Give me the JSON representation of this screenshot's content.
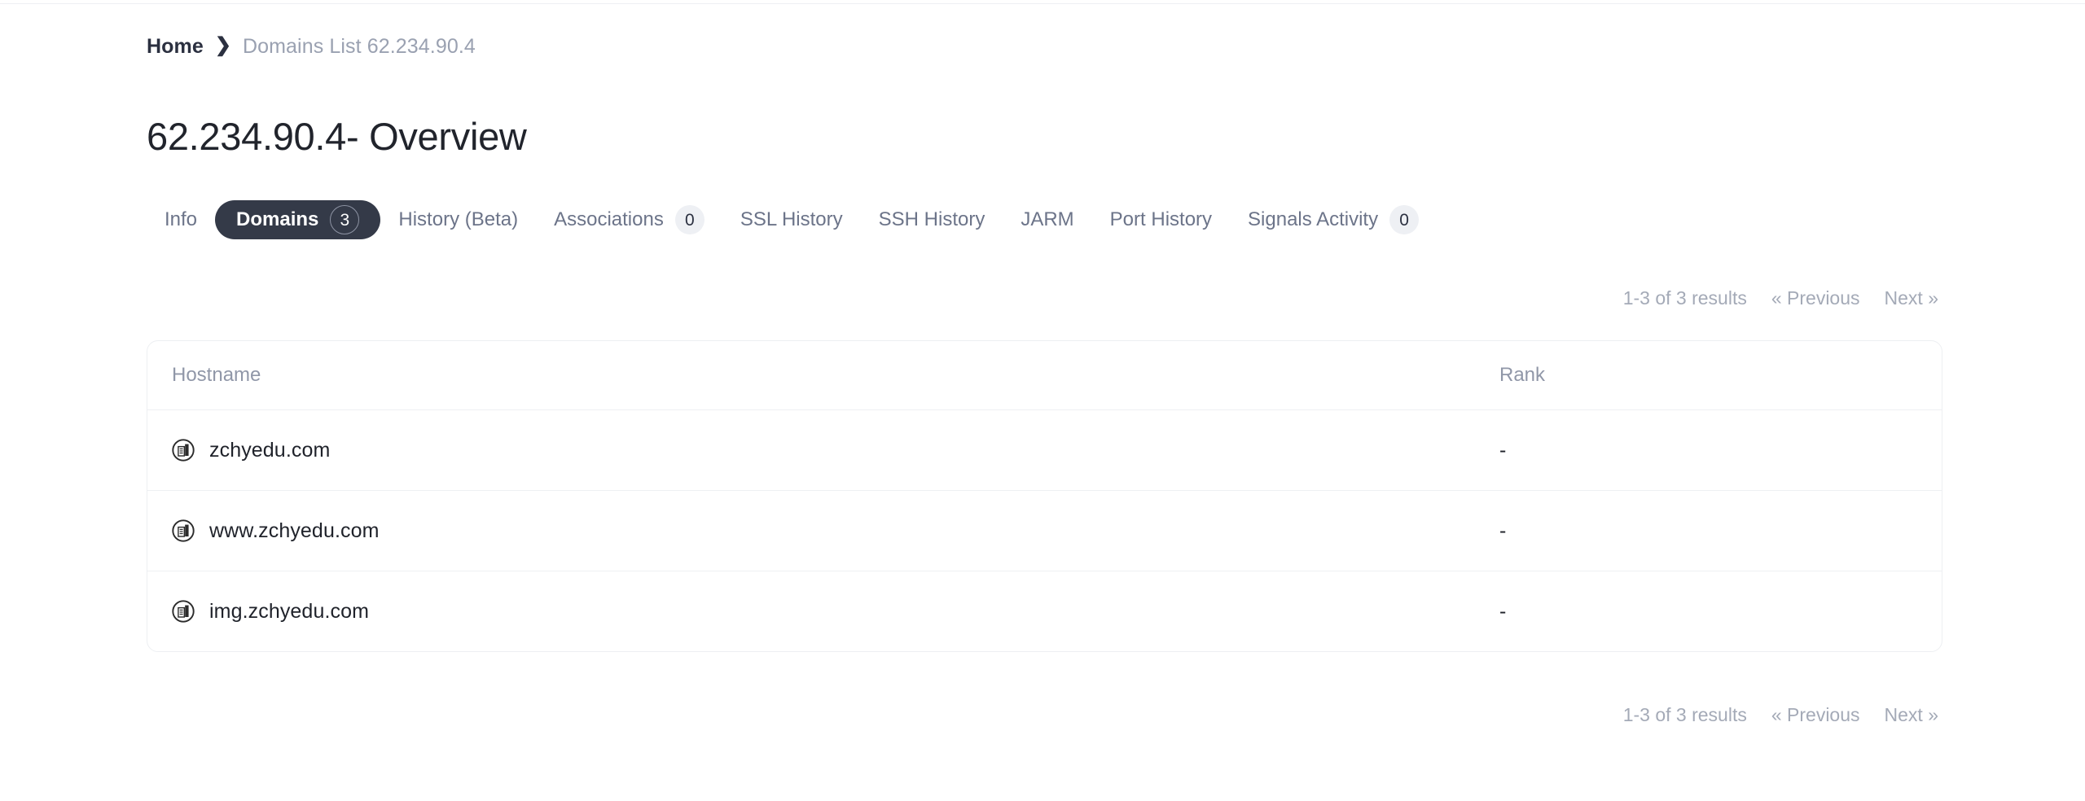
{
  "breadcrumb": {
    "home_label": "Home",
    "separator": "❯",
    "current_label": "Domains List 62.234.90.4"
  },
  "page_title": "62.234.90.4- Overview",
  "tabs": [
    {
      "label": "Info",
      "badge": null,
      "active": false
    },
    {
      "label": "Domains",
      "badge": "3",
      "active": true
    },
    {
      "label": "History (Beta)",
      "badge": null,
      "active": false
    },
    {
      "label": "Associations",
      "badge": "0",
      "active": false
    },
    {
      "label": "SSL History",
      "badge": null,
      "active": false
    },
    {
      "label": "SSH History",
      "badge": null,
      "active": false
    },
    {
      "label": "JARM",
      "badge": null,
      "active": false
    },
    {
      "label": "Port History",
      "badge": null,
      "active": false
    },
    {
      "label": "Signals Activity",
      "badge": "0",
      "active": false
    }
  ],
  "pagination": {
    "results_text": "1-3 of 3 results",
    "previous_label": "« Previous",
    "next_label": "Next »"
  },
  "table": {
    "columns": [
      {
        "key": "hostname",
        "label": "Hostname"
      },
      {
        "key": "rank",
        "label": "Rank"
      }
    ],
    "rows": [
      {
        "icon": "domain-building-icon",
        "hostname": "zchyedu.com",
        "rank": "-"
      },
      {
        "icon": "domain-building-icon",
        "hostname": "www.zchyedu.com",
        "rank": "-"
      },
      {
        "icon": "domain-building-icon",
        "hostname": "img.zchyedu.com",
        "rank": "-"
      }
    ]
  },
  "colors": {
    "active_tab_bg": "#343a48",
    "muted_text": "#9aa1b1",
    "title_text": "#21242c",
    "card_border": "#edeff2"
  }
}
